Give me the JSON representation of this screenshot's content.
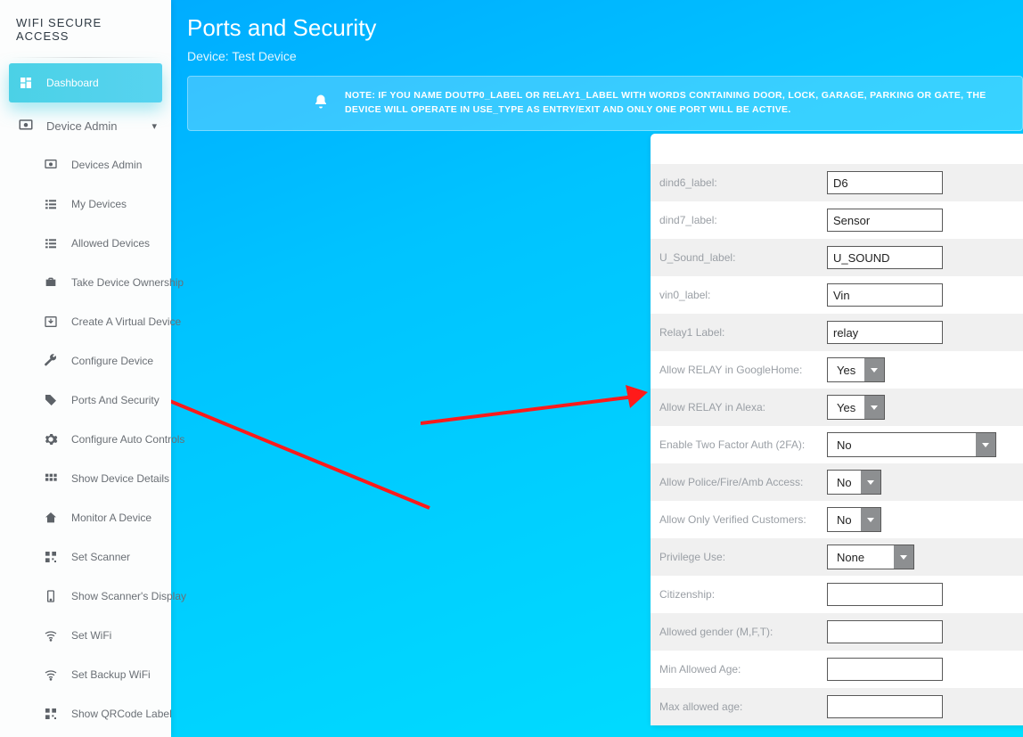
{
  "brand": "WIFI SECURE ACCESS",
  "sidebar": {
    "dashboard": "Dashboard",
    "device_admin": "Device Admin",
    "items": [
      "Devices Admin",
      "My Devices",
      "Allowed Devices",
      "Take Device Ownership",
      "Create A Virtual Device",
      "Configure Device",
      "Ports And Security",
      "Configure Auto Controls",
      "Show Device Details",
      "Monitor A Device",
      "Set Scanner",
      "Show Scanner's Display",
      "Set WiFi",
      "Set Backup WiFi",
      "Show QRCode Label"
    ]
  },
  "page": {
    "title": "Ports and Security",
    "subtitle": "Device: Test Device",
    "note": "NOTE: IF YOU NAME DOUTP0_LABEL OR RELAY1_LABEL WITH WORDS CONTAINING DOOR, LOCK, GARAGE, PARKING OR GATE, THE DEVICE WILL OPERATE IN USE_TYPE AS ENTRY/EXIT AND ONLY ONE PORT WILL BE ACTIVE."
  },
  "form": [
    {
      "label": "dind6_label:",
      "type": "text",
      "value": "D6"
    },
    {
      "label": "dind7_label:",
      "type": "text",
      "value": "Sensor"
    },
    {
      "label": "U_Sound_label:",
      "type": "text",
      "value": "U_SOUND"
    },
    {
      "label": "vin0_label:",
      "type": "text",
      "value": "Vin"
    },
    {
      "label": "Relay1 Label:",
      "type": "text",
      "value": "relay"
    },
    {
      "label": "Allow RELAY in GoogleHome:",
      "type": "select",
      "value": "Yes",
      "size": "small"
    },
    {
      "label": "Allow RELAY in Alexa:",
      "type": "select",
      "value": "Yes",
      "size": "small"
    },
    {
      "label": "Enable Two Factor Auth (2FA):",
      "type": "select",
      "value": "No",
      "size": "wide"
    },
    {
      "label": "Allow Police/Fire/Amb Access:",
      "type": "select",
      "value": "No",
      "size": "small"
    },
    {
      "label": "Allow Only Verified Customers:",
      "type": "select",
      "value": "No",
      "size": "small"
    },
    {
      "label": "Privilege Use:",
      "type": "select",
      "value": "None",
      "size": "mid"
    },
    {
      "label": "Citizenship:",
      "type": "text",
      "value": ""
    },
    {
      "label": "Allowed gender (M,F,T):",
      "type": "text",
      "value": ""
    },
    {
      "label": "Min Allowed Age:",
      "type": "text",
      "value": ""
    },
    {
      "label": "Max allowed age:",
      "type": "text",
      "value": ""
    }
  ]
}
